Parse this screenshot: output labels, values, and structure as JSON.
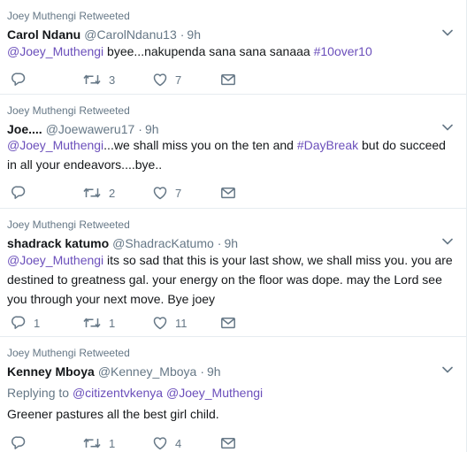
{
  "tweets": [
    {
      "context": "Joey Muthengi Retweeted",
      "name": "Carol Ndanu",
      "handle": "@CarolNdanu13",
      "time": "9h",
      "text_parts": [
        {
          "t": "@Joey_Muthengi",
          "k": "mention"
        },
        {
          "t": " byee...nakupenda sana sana sanaaa ",
          "k": "plain"
        },
        {
          "t": "#10over10",
          "k": "hashtag"
        }
      ],
      "actions": {
        "reply_count": "",
        "retweet_count": "3",
        "like_count": "7"
      }
    },
    {
      "context": "Joey Muthengi Retweeted",
      "name": "Joe....",
      "handle": "@Joewaweru17",
      "time": "9h",
      "text_parts": [
        {
          "t": "@Joey_Muthengi",
          "k": "mention"
        },
        {
          "t": "...we shall miss you on the ten and ",
          "k": "plain"
        },
        {
          "t": "#DayBreak",
          "k": "hashtag"
        },
        {
          "t": " but do succeed in all your endeavors....bye..",
          "k": "plain"
        }
      ],
      "actions": {
        "reply_count": "",
        "retweet_count": "2",
        "like_count": "7"
      }
    },
    {
      "context": "Joey Muthengi Retweeted",
      "name": "shadrack katumo",
      "handle": "@ShadracKatumo",
      "time": "9h",
      "text_parts": [
        {
          "t": "@Joey_Muthengi",
          "k": "mention"
        },
        {
          "t": " its so sad that this is your last show, we shall miss you. you are destined to greatness  gal. your energy on the floor was dope. may the Lord see you through your next move. Bye joey",
          "k": "plain"
        }
      ],
      "actions": {
        "reply_count": "1",
        "retweet_count": "1",
        "like_count": "11"
      }
    },
    {
      "context": "Joey Muthengi Retweeted",
      "name": "Kenney Mboya",
      "handle": "@Kenney_Mboya",
      "time": "9h",
      "replying_to": {
        "prefix": "Replying to",
        "mentions": [
          "@citizentvkenya",
          "@Joey_Muthengi"
        ]
      },
      "text_parts": [
        {
          "t": "Greener pastures all the best girl child.",
          "k": "plain"
        }
      ],
      "actions": {
        "reply_count": "",
        "retweet_count": "1",
        "like_count": "4"
      }
    }
  ],
  "colors": {
    "link": "#6b4fbb",
    "muted": "#657786",
    "text": "#14171a",
    "divider": "#e6ecf0"
  },
  "icons": {
    "reply": "reply-icon",
    "retweet": "retweet-icon",
    "like": "heart-icon",
    "dm": "envelope-icon",
    "menu": "chevron-down-icon"
  }
}
